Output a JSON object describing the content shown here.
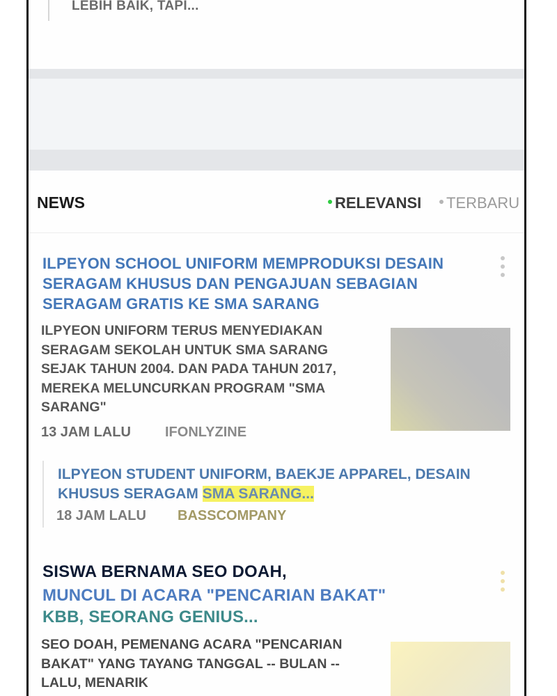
{
  "previous_item": {
    "snippet_tail": "LEBIH BAIK, TAPI..."
  },
  "news_section": {
    "title": "NEWS",
    "sort_options": [
      {
        "label": "RELEVANSI",
        "active": true
      },
      {
        "label": "TERBARU",
        "active": false
      }
    ],
    "accent_color": "#2ecc40"
  },
  "articles": [
    {
      "headline": "ILPEYON SCHOOL UNIFORM MEMPRODUKSI DESAIN SERAGAM KHUSUS DAN PENGAJUAN SEBAGIAN SERAGAM GRATIS KE SMA SARANG",
      "snippet": "ILPYEON UNIFORM TERUS MENYEDIAKAN SERAGAM SEKOLAH UNTUK SMA SARANG SEJAK TAHUN 2004. DAN PADA TAHUN 2017, MEREKA MELUNCURKAN PROGRAM \"SMA SARANG\"",
      "time": "13 JAM LALU",
      "source": "IFONLYZINE",
      "related": {
        "title_prefix": "ILPYEON STUDENT UNIFORM, BAEKJE APPAREL, DESAIN KHUSUS SERAGAM ",
        "title_highlight": "SMA SARANG...",
        "time": "18 JAM LALU",
        "source": "BASSCOMPANY"
      }
    },
    {
      "headline_line1": "SISWA BERNAMA SEO DOAH,",
      "headline_line2a": "MUNCUL DI ACARA \"PENCARIAN BAKAT\"",
      "headline_line2b": "KBB, SEORANG GENIUS...",
      "snippet": "SEO DOAH, PEMENANG ACARA \"PENCARIAN BAKAT\" YANG TAYANG TANGGAL -- BULAN -- LALU, MENARIK"
    }
  ],
  "colors": {
    "headline_blue": "#4477b8",
    "highlight_yellow": "#f6f261"
  }
}
